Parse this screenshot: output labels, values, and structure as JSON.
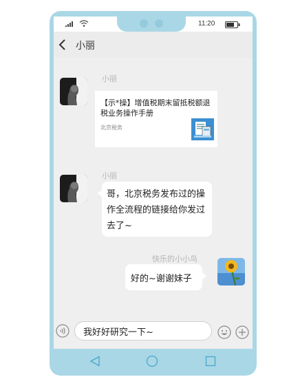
{
  "status_bar": {
    "time": "11:20"
  },
  "header": {
    "contact_name": "小丽",
    "back_icon": "chevron-left-icon"
  },
  "messages": [
    {
      "sender": "小丽",
      "type": "link-card",
      "card_title": "【示*操】增值税期末留抵税额退税业务操作手册",
      "card_source": "北京税务"
    },
    {
      "sender": "小丽",
      "type": "text",
      "text": "哥，北京税务发布过的操作全流程的链接给你发过去了~"
    },
    {
      "sender": "快乐的小小鸟",
      "type": "text",
      "text": "好的~谢谢妹子"
    }
  ],
  "input_bar": {
    "value": "我好好研究一下~"
  },
  "icons": {
    "voice": "voice-icon",
    "emoji": "emoji-icon",
    "plus": "plus-icon",
    "nav": [
      "nav-back-icon",
      "nav-home-icon",
      "nav-recent-icon"
    ]
  },
  "colors": {
    "frame": "#a9d7e6",
    "chat_background": "#efefef",
    "nav_icons": "#48a6c9"
  }
}
